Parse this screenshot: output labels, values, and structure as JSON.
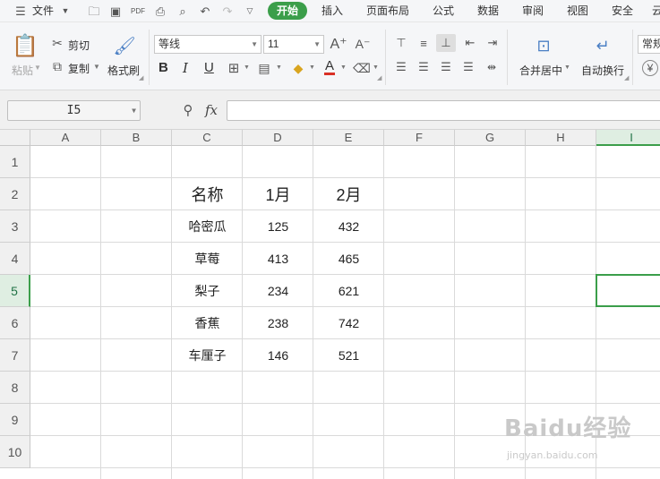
{
  "menubar": {
    "file": "文件",
    "tabs": [
      "开始",
      "插入",
      "页面布局",
      "公式",
      "数据",
      "审阅",
      "视图",
      "安全"
    ],
    "active_tab": "开始",
    "overflow_glyph": "云"
  },
  "ribbon": {
    "paste": "粘贴",
    "cut": "剪切",
    "copy": "复制",
    "format_painter": "格式刷",
    "font_name": "等线",
    "font_size": "11",
    "merge_center": "合并居中",
    "wrap_text": "自动换行",
    "number_format": "常规",
    "bold": "B",
    "italic": "I",
    "underline": "U",
    "font_color_letter": "A"
  },
  "formula_bar": {
    "name_box": "I5",
    "fx": "fx",
    "formula": ""
  },
  "grid": {
    "columns": [
      "A",
      "B",
      "C",
      "D",
      "E",
      "F",
      "G",
      "H",
      "I"
    ],
    "rows": [
      "1",
      "2",
      "3",
      "4",
      "5",
      "6",
      "7",
      "8",
      "9",
      "10"
    ],
    "selected_column": "I",
    "selected_row": "5",
    "table": {
      "headers": [
        "名称",
        "1月",
        "2月"
      ],
      "rows": [
        [
          "哈密瓜",
          "125",
          "432"
        ],
        [
          "草莓",
          "413",
          "465"
        ],
        [
          "梨子",
          "234",
          "621"
        ],
        [
          "香蕉",
          "238",
          "742"
        ],
        [
          "车厘子",
          "146",
          "521"
        ]
      ]
    }
  },
  "watermark": {
    "main": "Baidu经验",
    "sub": "jingyan.baidu.com"
  },
  "colors": {
    "accent_green": "#3b9e4a"
  }
}
